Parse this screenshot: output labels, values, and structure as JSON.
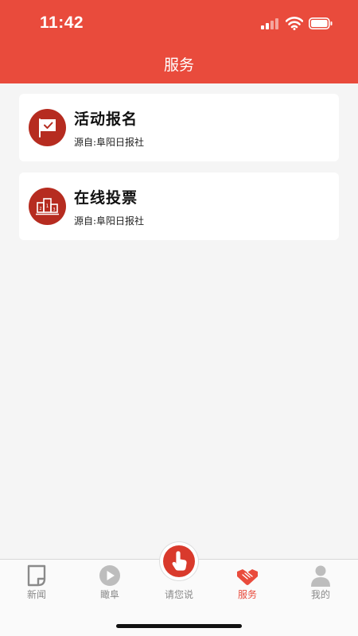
{
  "status_bar": {
    "time": "11:42"
  },
  "header": {
    "title": "服务"
  },
  "cards": [
    {
      "title": "活动报名",
      "source": "源自:阜阳日报社",
      "icon": "flag-check-icon"
    },
    {
      "title": "在线投票",
      "source": "源自:阜阳日报社",
      "icon": "podium-icon"
    }
  ],
  "tabbar": {
    "tabs": [
      {
        "label": "新闻",
        "icon": "news-icon"
      },
      {
        "label": "瞰阜",
        "icon": "play-icon"
      },
      {
        "label": "请您说",
        "icon": "tap-hand-icon"
      },
      {
        "label": "服务",
        "icon": "handshake-icon",
        "active": true
      },
      {
        "label": "我的",
        "icon": "person-icon"
      }
    ]
  },
  "colors": {
    "accent": "#e94b3c",
    "icon_bg": "#b62c20",
    "inactive": "#8a8a8a"
  }
}
